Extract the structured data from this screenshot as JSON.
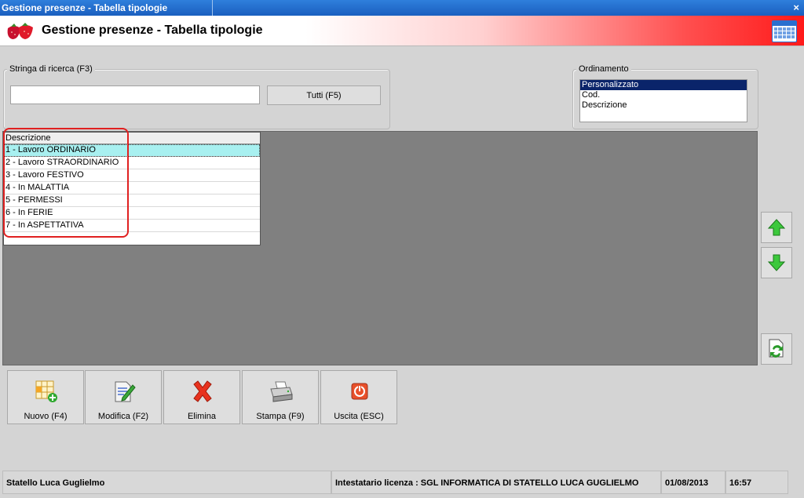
{
  "window": {
    "title": "Gestione presenze - Tabella tipologie",
    "close_glyph": "×"
  },
  "header": {
    "title": "Gestione presenze - Tabella tipologie",
    "logo_icon": "strawberry-icon",
    "calendar_icon": "calendar-icon"
  },
  "search": {
    "group_label": "Stringa di ricerca (F3)",
    "value": "",
    "all_button": "Tutti (F5)"
  },
  "ordering": {
    "group_label": "Ordinamento",
    "options": [
      "Personalizzato",
      "Cod.",
      "Descrizione"
    ],
    "selected": "Personalizzato"
  },
  "table": {
    "columns": [
      "Descrizione"
    ],
    "rows": [
      "1 - Lavoro ORDINARIO",
      "2 - Lavoro STRAORDINARIO",
      "3 - Lavoro FESTIVO",
      "4 - In MALATTIA",
      "5 - PERMESSI",
      "6 - In FERIE",
      "7 - In ASPETTATIVA"
    ],
    "selected_row": 0
  },
  "side_buttons": {
    "up_icon": "arrow-up-icon",
    "down_icon": "arrow-down-icon",
    "refresh_icon": "document-refresh-icon"
  },
  "toolbar": {
    "new_label": "Nuovo (F4)",
    "edit_label": "Modifica (F2)",
    "delete_label": "Elimina",
    "print_label": "Stampa (F9)",
    "exit_label": "Uscita (ESC)"
  },
  "status": {
    "user": "Statello Luca Guglielmo",
    "license": "Intestatario licenza : SGL  INFORMATICA DI STATELLO LUCA GUGLIELMO",
    "date": "01/08/2013",
    "time": "16:57"
  },
  "colors": {
    "header_accent": "#ff1a1a",
    "selection_blue": "#0a246a",
    "row_highlight": "#a8f0f0",
    "annotation_red": "#e02020"
  }
}
